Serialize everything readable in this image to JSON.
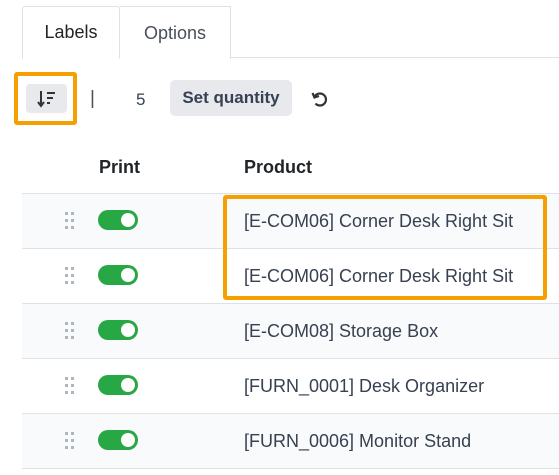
{
  "tabs": [
    {
      "label": "Labels",
      "active": true
    },
    {
      "label": "Options",
      "active": false
    }
  ],
  "toolbar": {
    "sort_icon": "sort-descending-icon",
    "separator": "|",
    "quantity": "5",
    "set_quantity_label": "Set quantity",
    "reload_icon": "reload-icon"
  },
  "table": {
    "headers": {
      "print": "Print",
      "product": "Product"
    },
    "rows": [
      {
        "product": "[E-COM06] Corner Desk Right Sit",
        "print": true
      },
      {
        "product": "[E-COM06] Corner Desk Right Sit",
        "print": true
      },
      {
        "product": "[E-COM08] Storage Box",
        "print": true
      },
      {
        "product": "[FURN_0001] Desk Organizer",
        "print": true
      },
      {
        "product": "[FURN_0006] Monitor Stand",
        "print": true
      }
    ]
  },
  "colors": {
    "highlight": "#f5a000",
    "toggle_on": "#28a745",
    "button_bg": "#e7e9ed"
  }
}
